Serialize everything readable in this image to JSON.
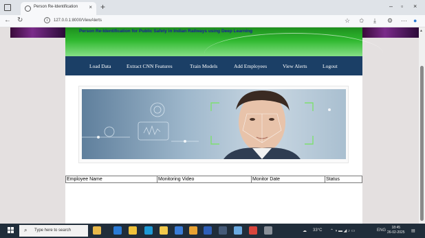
{
  "browser": {
    "tab_title": "Person Re-Identification",
    "tab_close": "×",
    "new_tab": "+",
    "url": "127.0.0.1:8000/ViewAlerts",
    "window_controls": {
      "minimize": "–",
      "maximize": "▫",
      "close": "×"
    },
    "icons": [
      "back-icon",
      "refresh-icon",
      "info-icon",
      "favorite-icon",
      "collections-icon",
      "downloads-icon",
      "extensions-icon",
      "more-icon",
      "edge-icon"
    ]
  },
  "site": {
    "title": "Person Re-Identification for Public Safety in Indian Railways using Deep Learning",
    "nav": [
      "Load Data",
      "Extract CNN Features",
      "Train Models",
      "Add Employees",
      "View Alerts",
      "Logout"
    ]
  },
  "table": {
    "headers": [
      "Employee Name",
      "Monitoring Video",
      "Monitor Date",
      "Status"
    ]
  },
  "taskbar": {
    "search_placeholder": "Type here to search",
    "weather": "33°C",
    "language": "ENG",
    "time": "18:45",
    "date": "26-02-2025"
  },
  "colors": {
    "header_green": "#2fb82f",
    "nav_blue": "#1b3f66",
    "title_blue": "#1a1aa0",
    "page_bg": "#e4e0e0"
  }
}
